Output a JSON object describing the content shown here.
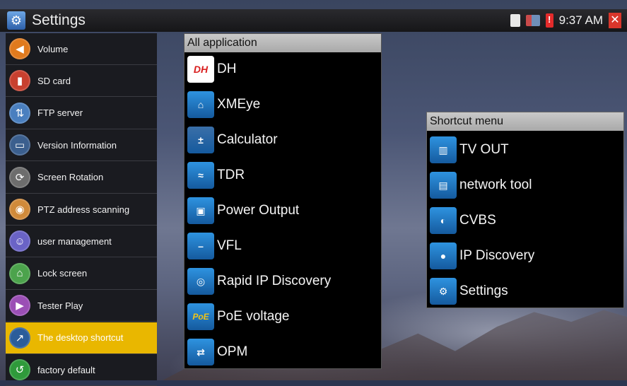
{
  "statusbar": {
    "title": "Settings",
    "time": "9:37 AM",
    "icons": [
      "sd-card-icon",
      "usb-icon",
      "battery-warning-icon",
      "close-icon"
    ]
  },
  "sidebar": {
    "items": [
      {
        "label": "Volume",
        "icon": "volume-icon",
        "color": "#e07a1e",
        "glyph": "◀"
      },
      {
        "label": "SD card",
        "icon": "sd-card-icon",
        "color": "#c8402f",
        "glyph": "▮"
      },
      {
        "label": "FTP server",
        "icon": "ftp-server-icon",
        "color": "#4a7fbf",
        "glyph": "⇅"
      },
      {
        "label": "Version Information",
        "icon": "version-info-icon",
        "color": "#3b5f8e",
        "glyph": "▭"
      },
      {
        "label": "Screen Rotation",
        "icon": "screen-rotation-icon",
        "color": "#6d6d6d",
        "glyph": "⟳"
      },
      {
        "label": "PTZ address scanning",
        "icon": "ptz-camera-icon",
        "color": "#d08a3a",
        "glyph": "◉"
      },
      {
        "label": "user management",
        "icon": "user-management-icon",
        "color": "#6a63c6",
        "glyph": "☺"
      },
      {
        "label": "Lock screen",
        "icon": "lock-icon",
        "color": "#4ca34c",
        "glyph": "⌂"
      },
      {
        "label": "Tester Play",
        "icon": "tester-play-icon",
        "color": "#9b4fb5",
        "glyph": "▶"
      },
      {
        "label": "The desktop shortcut",
        "icon": "desktop-shortcut-icon",
        "color": "#2b5d9a",
        "glyph": "↗"
      },
      {
        "label": "factory default",
        "icon": "factory-default-icon",
        "color": "#2f9a3b",
        "glyph": "↺"
      }
    ],
    "active_index": 9,
    "active_color": "#e9b700"
  },
  "all_application": {
    "header": "All application",
    "items": [
      {
        "label": "DH",
        "icon": "dh-icon",
        "glyph": "DH",
        "color": "#1a4db8"
      },
      {
        "label": "XMEye",
        "icon": "xmeye-icon",
        "glyph": "⌂",
        "color": "#2e93e0"
      },
      {
        "label": "Calculator",
        "icon": "calculator-icon",
        "glyph": "±",
        "color": "#3a6fa8"
      },
      {
        "label": "TDR",
        "icon": "tdr-icon",
        "glyph": "≈",
        "color": "#2e93e0"
      },
      {
        "label": "Power Output",
        "icon": "power-output-icon",
        "glyph": "▣",
        "color": "#2e93e0"
      },
      {
        "label": "VFL",
        "icon": "vfl-icon",
        "glyph": "–",
        "color": "#2e93e0"
      },
      {
        "label": "Rapid IP Discovery",
        "icon": "rapid-ip-discovery-icon",
        "glyph": "◎",
        "color": "#2e93e0"
      },
      {
        "label": "PoE voltage",
        "icon": "poe-voltage-icon",
        "glyph": "PoE",
        "color": "#2e93e0"
      },
      {
        "label": "OPM",
        "icon": "opm-icon",
        "glyph": "⇄",
        "color": "#2e93e0"
      }
    ]
  },
  "shortcut_menu": {
    "header": "Shortcut menu",
    "items": [
      {
        "label": "TV OUT",
        "icon": "tv-out-icon",
        "glyph": "▥",
        "color": "#2e93e0"
      },
      {
        "label": "network tool",
        "icon": "network-tool-icon",
        "glyph": "▤",
        "color": "#2e93e0"
      },
      {
        "label": "CVBS",
        "icon": "cvbs-camera-icon",
        "glyph": "◐",
        "color": "#2e93e0"
      },
      {
        "label": "IP Discovery",
        "icon": "ip-discovery-icon",
        "glyph": "●",
        "color": "#2e93e0"
      },
      {
        "label": "Settings",
        "icon": "settings-gear-icon",
        "glyph": "⚙",
        "color": "#2e93e0"
      }
    ]
  }
}
